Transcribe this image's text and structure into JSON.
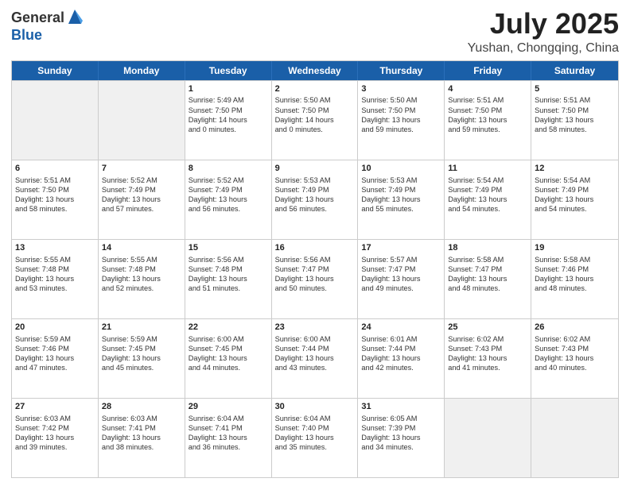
{
  "header": {
    "logo_general": "General",
    "logo_blue": "Blue",
    "month": "July 2025",
    "location": "Yushan, Chongqing, China"
  },
  "days_of_week": [
    "Sunday",
    "Monday",
    "Tuesday",
    "Wednesday",
    "Thursday",
    "Friday",
    "Saturday"
  ],
  "weeks": [
    [
      {
        "day": "",
        "info": "",
        "shaded": true
      },
      {
        "day": "",
        "info": "",
        "shaded": true
      },
      {
        "day": "1",
        "info": "Sunrise: 5:49 AM\nSunset: 7:50 PM\nDaylight: 14 hours\nand 0 minutes.",
        "shaded": false
      },
      {
        "day": "2",
        "info": "Sunrise: 5:50 AM\nSunset: 7:50 PM\nDaylight: 14 hours\nand 0 minutes.",
        "shaded": false
      },
      {
        "day": "3",
        "info": "Sunrise: 5:50 AM\nSunset: 7:50 PM\nDaylight: 13 hours\nand 59 minutes.",
        "shaded": false
      },
      {
        "day": "4",
        "info": "Sunrise: 5:51 AM\nSunset: 7:50 PM\nDaylight: 13 hours\nand 59 minutes.",
        "shaded": false
      },
      {
        "day": "5",
        "info": "Sunrise: 5:51 AM\nSunset: 7:50 PM\nDaylight: 13 hours\nand 58 minutes.",
        "shaded": false
      }
    ],
    [
      {
        "day": "6",
        "info": "Sunrise: 5:51 AM\nSunset: 7:50 PM\nDaylight: 13 hours\nand 58 minutes.",
        "shaded": false
      },
      {
        "day": "7",
        "info": "Sunrise: 5:52 AM\nSunset: 7:49 PM\nDaylight: 13 hours\nand 57 minutes.",
        "shaded": false
      },
      {
        "day": "8",
        "info": "Sunrise: 5:52 AM\nSunset: 7:49 PM\nDaylight: 13 hours\nand 56 minutes.",
        "shaded": false
      },
      {
        "day": "9",
        "info": "Sunrise: 5:53 AM\nSunset: 7:49 PM\nDaylight: 13 hours\nand 56 minutes.",
        "shaded": false
      },
      {
        "day": "10",
        "info": "Sunrise: 5:53 AM\nSunset: 7:49 PM\nDaylight: 13 hours\nand 55 minutes.",
        "shaded": false
      },
      {
        "day": "11",
        "info": "Sunrise: 5:54 AM\nSunset: 7:49 PM\nDaylight: 13 hours\nand 54 minutes.",
        "shaded": false
      },
      {
        "day": "12",
        "info": "Sunrise: 5:54 AM\nSunset: 7:49 PM\nDaylight: 13 hours\nand 54 minutes.",
        "shaded": false
      }
    ],
    [
      {
        "day": "13",
        "info": "Sunrise: 5:55 AM\nSunset: 7:48 PM\nDaylight: 13 hours\nand 53 minutes.",
        "shaded": false
      },
      {
        "day": "14",
        "info": "Sunrise: 5:55 AM\nSunset: 7:48 PM\nDaylight: 13 hours\nand 52 minutes.",
        "shaded": false
      },
      {
        "day": "15",
        "info": "Sunrise: 5:56 AM\nSunset: 7:48 PM\nDaylight: 13 hours\nand 51 minutes.",
        "shaded": false
      },
      {
        "day": "16",
        "info": "Sunrise: 5:56 AM\nSunset: 7:47 PM\nDaylight: 13 hours\nand 50 minutes.",
        "shaded": false
      },
      {
        "day": "17",
        "info": "Sunrise: 5:57 AM\nSunset: 7:47 PM\nDaylight: 13 hours\nand 49 minutes.",
        "shaded": false
      },
      {
        "day": "18",
        "info": "Sunrise: 5:58 AM\nSunset: 7:47 PM\nDaylight: 13 hours\nand 48 minutes.",
        "shaded": false
      },
      {
        "day": "19",
        "info": "Sunrise: 5:58 AM\nSunset: 7:46 PM\nDaylight: 13 hours\nand 48 minutes.",
        "shaded": false
      }
    ],
    [
      {
        "day": "20",
        "info": "Sunrise: 5:59 AM\nSunset: 7:46 PM\nDaylight: 13 hours\nand 47 minutes.",
        "shaded": false
      },
      {
        "day": "21",
        "info": "Sunrise: 5:59 AM\nSunset: 7:45 PM\nDaylight: 13 hours\nand 45 minutes.",
        "shaded": false
      },
      {
        "day": "22",
        "info": "Sunrise: 6:00 AM\nSunset: 7:45 PM\nDaylight: 13 hours\nand 44 minutes.",
        "shaded": false
      },
      {
        "day": "23",
        "info": "Sunrise: 6:00 AM\nSunset: 7:44 PM\nDaylight: 13 hours\nand 43 minutes.",
        "shaded": false
      },
      {
        "day": "24",
        "info": "Sunrise: 6:01 AM\nSunset: 7:44 PM\nDaylight: 13 hours\nand 42 minutes.",
        "shaded": false
      },
      {
        "day": "25",
        "info": "Sunrise: 6:02 AM\nSunset: 7:43 PM\nDaylight: 13 hours\nand 41 minutes.",
        "shaded": false
      },
      {
        "day": "26",
        "info": "Sunrise: 6:02 AM\nSunset: 7:43 PM\nDaylight: 13 hours\nand 40 minutes.",
        "shaded": false
      }
    ],
    [
      {
        "day": "27",
        "info": "Sunrise: 6:03 AM\nSunset: 7:42 PM\nDaylight: 13 hours\nand 39 minutes.",
        "shaded": false
      },
      {
        "day": "28",
        "info": "Sunrise: 6:03 AM\nSunset: 7:41 PM\nDaylight: 13 hours\nand 38 minutes.",
        "shaded": false
      },
      {
        "day": "29",
        "info": "Sunrise: 6:04 AM\nSunset: 7:41 PM\nDaylight: 13 hours\nand 36 minutes.",
        "shaded": false
      },
      {
        "day": "30",
        "info": "Sunrise: 6:04 AM\nSunset: 7:40 PM\nDaylight: 13 hours\nand 35 minutes.",
        "shaded": false
      },
      {
        "day": "31",
        "info": "Sunrise: 6:05 AM\nSunset: 7:39 PM\nDaylight: 13 hours\nand 34 minutes.",
        "shaded": false
      },
      {
        "day": "",
        "info": "",
        "shaded": true
      },
      {
        "day": "",
        "info": "",
        "shaded": true
      }
    ]
  ]
}
